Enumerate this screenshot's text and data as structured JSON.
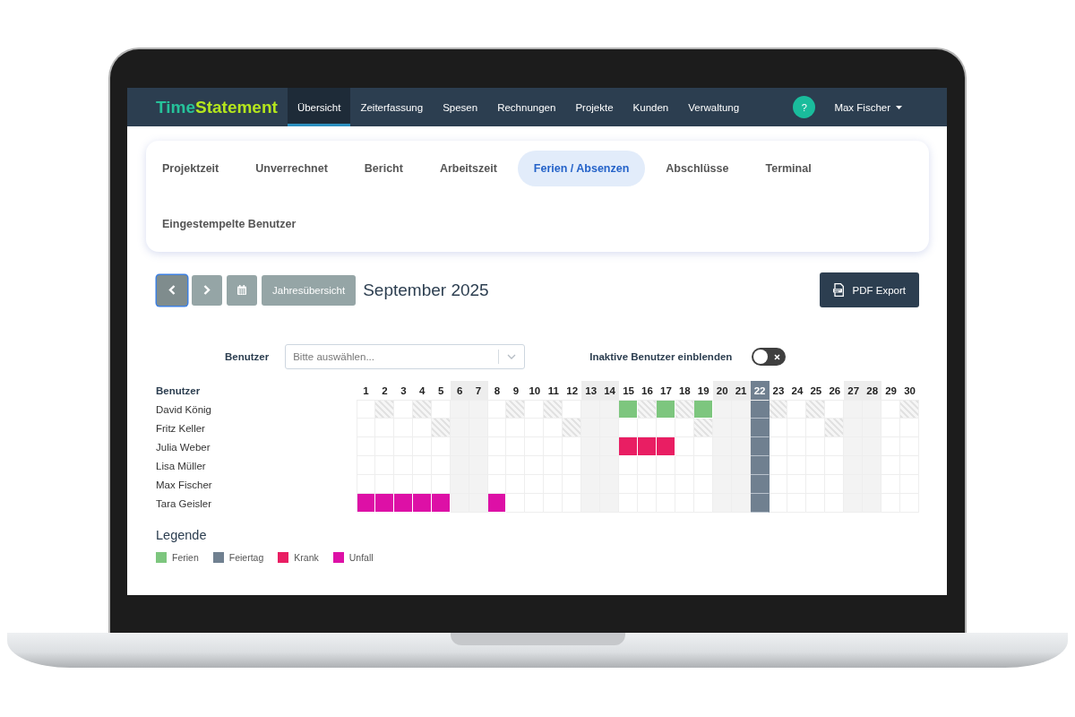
{
  "nav": {
    "logo": [
      {
        "text": "Time",
        "color": "#26c29a"
      },
      {
        "text": "Statement",
        "color": "#b5e61d"
      }
    ],
    "items": [
      {
        "label": "Übersicht",
        "selected": true
      },
      {
        "label": "Zeiterfassung",
        "selected": false
      },
      {
        "label": "Spesen",
        "selected": false
      },
      {
        "label": "Rechnungen",
        "selected": false
      },
      {
        "label": "Projekte",
        "selected": false
      },
      {
        "label": "Kunden",
        "selected": false
      },
      {
        "label": "Verwaltung",
        "selected": false
      }
    ],
    "help": "?",
    "user": "Max Fischer"
  },
  "subtabs": [
    {
      "label": "Projektzeit",
      "selected": false
    },
    {
      "label": "Unverrechnet",
      "selected": false
    },
    {
      "label": "Bericht",
      "selected": false
    },
    {
      "label": "Arbeitszeit",
      "selected": false
    },
    {
      "label": "Ferien / Absenzen",
      "selected": true
    },
    {
      "label": "Abschlüsse",
      "selected": false
    },
    {
      "label": "Terminal",
      "selected": false
    },
    {
      "label": "Eingestempelte Benutzer",
      "selected": false
    }
  ],
  "toolbar": {
    "buttons": [
      {
        "kind": "prev",
        "focused": true
      },
      {
        "kind": "next",
        "focused": false
      },
      {
        "kind": "calendar",
        "focused": false
      },
      {
        "kind": "text",
        "label": "Jahresübersicht",
        "focused": false
      }
    ],
    "title": "September 2025",
    "export": "PDF Export"
  },
  "filter": {
    "label": "Benutzer",
    "placeholder": "Bitte auswählen...",
    "toggle_label": "Inaktive Benutzer einblenden",
    "toggle_on": false
  },
  "calendar": {
    "name_header": "Benutzer",
    "days": [
      {
        "label": "1",
        "kind": "workday"
      },
      {
        "label": "2",
        "kind": "workday"
      },
      {
        "label": "3",
        "kind": "workday"
      },
      {
        "label": "4",
        "kind": "workday"
      },
      {
        "label": "5",
        "kind": "workday"
      },
      {
        "label": "6",
        "kind": "weekend"
      },
      {
        "label": "7",
        "kind": "weekend"
      },
      {
        "label": "8",
        "kind": "workday"
      },
      {
        "label": "9",
        "kind": "workday"
      },
      {
        "label": "10",
        "kind": "workday"
      },
      {
        "label": "11",
        "kind": "workday"
      },
      {
        "label": "12",
        "kind": "workday"
      },
      {
        "label": "13",
        "kind": "weekend"
      },
      {
        "label": "14",
        "kind": "weekend"
      },
      {
        "label": "15",
        "kind": "workday"
      },
      {
        "label": "16",
        "kind": "workday"
      },
      {
        "label": "17",
        "kind": "workday"
      },
      {
        "label": "18",
        "kind": "workday"
      },
      {
        "label": "19",
        "kind": "workday"
      },
      {
        "label": "20",
        "kind": "weekend"
      },
      {
        "label": "21",
        "kind": "weekend"
      },
      {
        "label": "22",
        "kind": "holiday"
      },
      {
        "label": "23",
        "kind": "workday"
      },
      {
        "label": "24",
        "kind": "workday"
      },
      {
        "label": "25",
        "kind": "workday"
      },
      {
        "label": "26",
        "kind": "workday"
      },
      {
        "label": "27",
        "kind": "weekend"
      },
      {
        "label": "28",
        "kind": "weekend"
      },
      {
        "label": "29",
        "kind": "workday"
      },
      {
        "label": "30",
        "kind": "workday"
      }
    ],
    "rows": [
      {
        "name": "David König",
        "cells": [
          {
            "kind": "free"
          },
          {
            "kind": "hatched"
          },
          {
            "kind": "free"
          },
          {
            "kind": "hatched"
          },
          {
            "kind": "free"
          },
          {
            "kind": "free"
          },
          {
            "kind": "free"
          },
          {
            "kind": "free"
          },
          {
            "kind": "hatched"
          },
          {
            "kind": "free"
          },
          {
            "kind": "hatched"
          },
          {
            "kind": "free"
          },
          {
            "kind": "free"
          },
          {
            "kind": "free"
          },
          {
            "kind": "absence",
            "color": "#7dc67e"
          },
          {
            "kind": "hatched"
          },
          {
            "kind": "absence",
            "color": "#7dc67e"
          },
          {
            "kind": "hatched"
          },
          {
            "kind": "absence",
            "color": "#7dc67e"
          },
          {
            "kind": "free"
          },
          {
            "kind": "free"
          },
          {
            "kind": "free"
          },
          {
            "kind": "hatched"
          },
          {
            "kind": "free"
          },
          {
            "kind": "hatched"
          },
          {
            "kind": "free"
          },
          {
            "kind": "free"
          },
          {
            "kind": "free"
          },
          {
            "kind": "free"
          },
          {
            "kind": "hatched"
          }
        ]
      },
      {
        "name": "Fritz Keller",
        "cells": [
          {
            "kind": "free"
          },
          {
            "kind": "free"
          },
          {
            "kind": "free"
          },
          {
            "kind": "free"
          },
          {
            "kind": "hatched"
          },
          {
            "kind": "free"
          },
          {
            "kind": "free"
          },
          {
            "kind": "free"
          },
          {
            "kind": "free"
          },
          {
            "kind": "free"
          },
          {
            "kind": "free"
          },
          {
            "kind": "hatched"
          },
          {
            "kind": "free"
          },
          {
            "kind": "free"
          },
          {
            "kind": "free"
          },
          {
            "kind": "free"
          },
          {
            "kind": "free"
          },
          {
            "kind": "free"
          },
          {
            "kind": "hatched"
          },
          {
            "kind": "free"
          },
          {
            "kind": "free"
          },
          {
            "kind": "free"
          },
          {
            "kind": "free"
          },
          {
            "kind": "free"
          },
          {
            "kind": "free"
          },
          {
            "kind": "hatched"
          },
          {
            "kind": "free"
          },
          {
            "kind": "free"
          },
          {
            "kind": "free"
          },
          {
            "kind": "free"
          }
        ]
      },
      {
        "name": "Julia Weber",
        "cells": [
          {
            "kind": "free"
          },
          {
            "kind": "free"
          },
          {
            "kind": "free"
          },
          {
            "kind": "free"
          },
          {
            "kind": "free"
          },
          {
            "kind": "free"
          },
          {
            "kind": "free"
          },
          {
            "kind": "free"
          },
          {
            "kind": "free"
          },
          {
            "kind": "free"
          },
          {
            "kind": "free"
          },
          {
            "kind": "free"
          },
          {
            "kind": "free"
          },
          {
            "kind": "free"
          },
          {
            "kind": "absence",
            "color": "#e91e63"
          },
          {
            "kind": "absence",
            "color": "#e91e63"
          },
          {
            "kind": "absence",
            "color": "#e91e63"
          },
          {
            "kind": "free"
          },
          {
            "kind": "free"
          },
          {
            "kind": "free"
          },
          {
            "kind": "free"
          },
          {
            "kind": "free"
          },
          {
            "kind": "free"
          },
          {
            "kind": "free"
          },
          {
            "kind": "free"
          },
          {
            "kind": "free"
          },
          {
            "kind": "free"
          },
          {
            "kind": "free"
          },
          {
            "kind": "free"
          },
          {
            "kind": "free"
          }
        ]
      },
      {
        "name": "Lisa Müller",
        "cells": [
          {
            "kind": "free"
          },
          {
            "kind": "free"
          },
          {
            "kind": "free"
          },
          {
            "kind": "free"
          },
          {
            "kind": "free"
          },
          {
            "kind": "free"
          },
          {
            "kind": "free"
          },
          {
            "kind": "free"
          },
          {
            "kind": "free"
          },
          {
            "kind": "free"
          },
          {
            "kind": "free"
          },
          {
            "kind": "free"
          },
          {
            "kind": "free"
          },
          {
            "kind": "free"
          },
          {
            "kind": "free"
          },
          {
            "kind": "free"
          },
          {
            "kind": "free"
          },
          {
            "kind": "free"
          },
          {
            "kind": "free"
          },
          {
            "kind": "free"
          },
          {
            "kind": "free"
          },
          {
            "kind": "free"
          },
          {
            "kind": "free"
          },
          {
            "kind": "free"
          },
          {
            "kind": "free"
          },
          {
            "kind": "free"
          },
          {
            "kind": "free"
          },
          {
            "kind": "free"
          },
          {
            "kind": "free"
          },
          {
            "kind": "free"
          }
        ]
      },
      {
        "name": "Max Fischer",
        "cells": [
          {
            "kind": "free"
          },
          {
            "kind": "free"
          },
          {
            "kind": "free"
          },
          {
            "kind": "free"
          },
          {
            "kind": "free"
          },
          {
            "kind": "free"
          },
          {
            "kind": "free"
          },
          {
            "kind": "free"
          },
          {
            "kind": "free"
          },
          {
            "kind": "free"
          },
          {
            "kind": "free"
          },
          {
            "kind": "free"
          },
          {
            "kind": "free"
          },
          {
            "kind": "free"
          },
          {
            "kind": "free"
          },
          {
            "kind": "free"
          },
          {
            "kind": "free"
          },
          {
            "kind": "free"
          },
          {
            "kind": "free"
          },
          {
            "kind": "free"
          },
          {
            "kind": "free"
          },
          {
            "kind": "free"
          },
          {
            "kind": "free"
          },
          {
            "kind": "free"
          },
          {
            "kind": "free"
          },
          {
            "kind": "free"
          },
          {
            "kind": "free"
          },
          {
            "kind": "free"
          },
          {
            "kind": "free"
          },
          {
            "kind": "free"
          }
        ]
      },
      {
        "name": "Tara Geisler",
        "cells": [
          {
            "kind": "absence",
            "color": "#dd10a6"
          },
          {
            "kind": "absence",
            "color": "#dd10a6"
          },
          {
            "kind": "absence",
            "color": "#dd10a6"
          },
          {
            "kind": "absence",
            "color": "#dd10a6"
          },
          {
            "kind": "absence",
            "color": "#dd10a6"
          },
          {
            "kind": "free"
          },
          {
            "kind": "free"
          },
          {
            "kind": "absence",
            "color": "#dd10a6"
          },
          {
            "kind": "free"
          },
          {
            "kind": "free"
          },
          {
            "kind": "free"
          },
          {
            "kind": "free"
          },
          {
            "kind": "free"
          },
          {
            "kind": "free"
          },
          {
            "kind": "free"
          },
          {
            "kind": "free"
          },
          {
            "kind": "free"
          },
          {
            "kind": "free"
          },
          {
            "kind": "free"
          },
          {
            "kind": "free"
          },
          {
            "kind": "free"
          },
          {
            "kind": "free"
          },
          {
            "kind": "free"
          },
          {
            "kind": "free"
          },
          {
            "kind": "free"
          },
          {
            "kind": "free"
          },
          {
            "kind": "free"
          },
          {
            "kind": "free"
          },
          {
            "kind": "free"
          },
          {
            "kind": "free"
          }
        ]
      }
    ]
  },
  "legend": {
    "title": "Legende",
    "items": [
      {
        "label": "Ferien",
        "color": "#7dc67e"
      },
      {
        "label": "Feiertag",
        "color": "#708090"
      },
      {
        "label": "Krank",
        "color": "#e91e63"
      },
      {
        "label": "Unfall",
        "color": "#dd10a6"
      }
    ]
  }
}
